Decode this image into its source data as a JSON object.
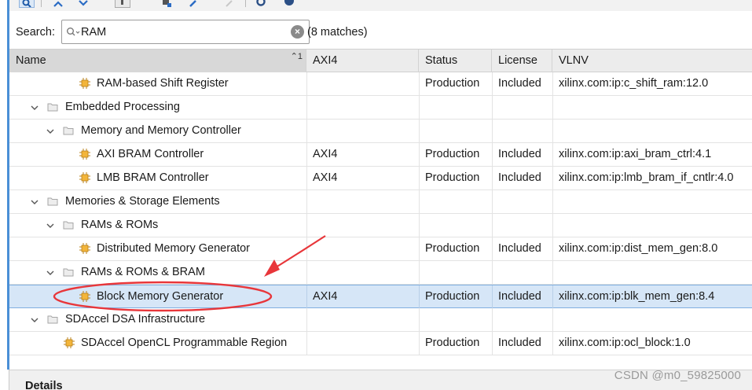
{
  "toolbar": {
    "buttons": [
      "search-icon",
      "collapse-all-icon",
      "expand-all-icon",
      "hierarchy-icon",
      "customize-icon",
      "edit-icon",
      "disabled-edit-icon",
      "settings-icon",
      "info-icon"
    ]
  },
  "search": {
    "label": "Search:",
    "value": "RAM",
    "placeholder": "",
    "match_count": "(8 matches)"
  },
  "table": {
    "columns": [
      {
        "label": "Name",
        "sort": "1"
      },
      {
        "label": "AXI4"
      },
      {
        "label": "Status"
      },
      {
        "label": "License"
      },
      {
        "label": "VLNV"
      }
    ],
    "rows": [
      {
        "kind": "ip",
        "depth": 3,
        "name": "RAM-based Shift Register",
        "axi4": "",
        "status": "Production",
        "license": "Included",
        "vlnv": "xilinx.com:ip:c_shift_ram:12.0",
        "selected": false
      },
      {
        "kind": "folder",
        "depth": 1,
        "name": "Embedded Processing",
        "axi4": "",
        "status": "",
        "license": "",
        "vlnv": "",
        "selected": false
      },
      {
        "kind": "folder",
        "depth": 2,
        "name": "Memory and Memory Controller",
        "axi4": "",
        "status": "",
        "license": "",
        "vlnv": "",
        "selected": false
      },
      {
        "kind": "ip",
        "depth": 3,
        "name": "AXI BRAM Controller",
        "axi4": "AXI4",
        "status": "Production",
        "license": "Included",
        "vlnv": "xilinx.com:ip:axi_bram_ctrl:4.1",
        "selected": false
      },
      {
        "kind": "ip",
        "depth": 3,
        "name": "LMB BRAM Controller",
        "axi4": "AXI4",
        "status": "Production",
        "license": "Included",
        "vlnv": "xilinx.com:ip:lmb_bram_if_cntlr:4.0",
        "selected": false
      },
      {
        "kind": "folder",
        "depth": 1,
        "name": "Memories & Storage Elements",
        "axi4": "",
        "status": "",
        "license": "",
        "vlnv": "",
        "selected": false
      },
      {
        "kind": "folder",
        "depth": 2,
        "name": "RAMs & ROMs",
        "axi4": "",
        "status": "",
        "license": "",
        "vlnv": "",
        "selected": false
      },
      {
        "kind": "ip",
        "depth": 3,
        "name": "Distributed Memory Generator",
        "axi4": "",
        "status": "Production",
        "license": "Included",
        "vlnv": "xilinx.com:ip:dist_mem_gen:8.0",
        "selected": false
      },
      {
        "kind": "folder",
        "depth": 2,
        "name": "RAMs & ROMs & BRAM",
        "axi4": "",
        "status": "",
        "license": "",
        "vlnv": "",
        "selected": false
      },
      {
        "kind": "ip",
        "depth": 3,
        "name": "Block Memory Generator",
        "axi4": "AXI4",
        "status": "Production",
        "license": "Included",
        "vlnv": "xilinx.com:ip:blk_mem_gen:8.4",
        "selected": true
      },
      {
        "kind": "folder",
        "depth": 1,
        "name": "SDAccel DSA Infrastructure",
        "axi4": "",
        "status": "",
        "license": "",
        "vlnv": "",
        "selected": false
      },
      {
        "kind": "ip",
        "depth": 2,
        "name": "SDAccel OpenCL Programmable Region",
        "axi4": "",
        "status": "Production",
        "license": "Included",
        "vlnv": "xilinx.com:ip:ocl_block:1.0",
        "selected": false
      }
    ]
  },
  "details": {
    "title": "Details"
  },
  "watermark": "CSDN @m0_59825000",
  "colors": {
    "selection": "#d6e6f7",
    "annotation": "#e8363a",
    "ip_chip": "#e8a51c"
  }
}
